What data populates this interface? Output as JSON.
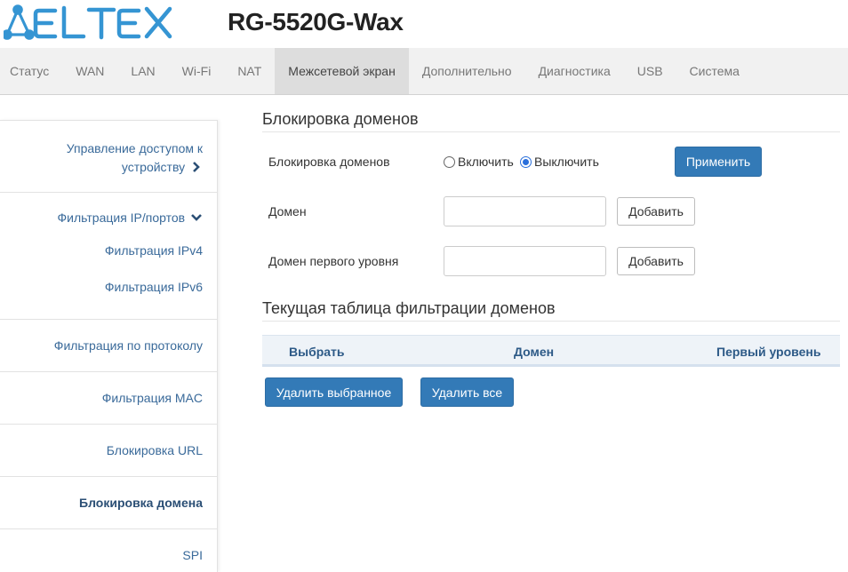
{
  "header": {
    "brand": "ELTEX",
    "model": "RG-5520G-Wax"
  },
  "colors": {
    "brand": "#3595d3",
    "accent": "#337ab7",
    "link": "#3a6a9a"
  },
  "nav": {
    "items": [
      {
        "label": "Статус"
      },
      {
        "label": "WAN"
      },
      {
        "label": "LAN"
      },
      {
        "label": "Wi-Fi"
      },
      {
        "label": "NAT"
      },
      {
        "label": "Межсетевой экран",
        "active": true
      },
      {
        "label": "Дополнительно"
      },
      {
        "label": "Диагностика"
      },
      {
        "label": "USB"
      },
      {
        "label": "Система"
      }
    ]
  },
  "sidebar": {
    "access_control_line1": "Управление доступом к",
    "access_control_line2": "устройству",
    "ip_port_filter": "Фильтрация IP/портов",
    "ipv4_filter": "Фильтрация IPv4",
    "ipv6_filter": "Фильтрация IPv6",
    "protocol_filter": "Фильтрация по протоколу",
    "mac_filter": "Фильтрация MAC",
    "url_block": "Блокировка URL",
    "domain_block": "Блокировка домена",
    "spi": "SPI"
  },
  "main": {
    "section_title": "Блокировка доменов",
    "domain_block_label": "Блокировка доменов",
    "radio_enable": "Включить",
    "radio_disable": "Выключить",
    "radio_selected": "Выключить",
    "apply_button": "Применить",
    "domain_label": "Домен",
    "domain_value": "",
    "add_button": "Добавить",
    "top_level_label": "Домен первого уровня",
    "top_level_value": "",
    "add_button_2": "Добавить",
    "table_title": "Текущая таблица фильтрации доменов",
    "table_columns": [
      "Выбрать",
      "Домен",
      "Первый уровень"
    ],
    "delete_selected_button": "Удалить выбранное",
    "delete_all_button": "Удалить все"
  }
}
